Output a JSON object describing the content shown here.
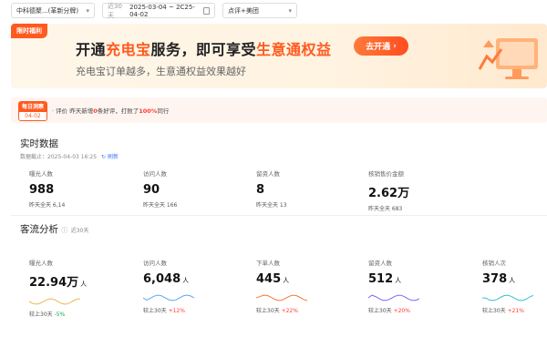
{
  "filters": {
    "store": "中科德聚...(革新分牌)",
    "date_tag": "近30天",
    "date_range": "2025-03-04 ~ 2C25-04-02",
    "area": "点评+美团"
  },
  "banner": {
    "ribbon": "限时福利",
    "headline_pre": "开通",
    "headline_hl1": "充电宝",
    "headline_mid": "服务，即可享受",
    "headline_hl2": "生意通权益",
    "sub": "充电宝订单越多，生意通权益效果越好",
    "cta": "去开通",
    "colors": {
      "accent": "#ff5a1f"
    }
  },
  "tip": {
    "badge_top": "每日洞察",
    "badge_date": "04-02",
    "msg_pre": "· 评价 昨天新增",
    "msg_count": "0",
    "msg_mid": "条好评，打败了",
    "msg_pct": "100%",
    "msg_post": "同行"
  },
  "realtime": {
    "title": "实时数据",
    "meta": "数据截止：2025-04-03 16:25",
    "refresh": "刷新",
    "metrics": [
      {
        "label": "曝光人数",
        "value": "988",
        "compare": "昨天全天 6,14"
      },
      {
        "label": "访问人数",
        "value": "90",
        "compare": "昨天全天 166"
      },
      {
        "label": "留资人数",
        "value": "8",
        "compare": "昨天全天 13"
      },
      {
        "label": "核销售价金额",
        "value": "2.62万",
        "compare": "昨天全天 683"
      }
    ]
  },
  "traffic": {
    "title": "客流分析",
    "meta": "近30天",
    "metrics": [
      {
        "label": "曝光人数",
        "value": "22.94万",
        "unit": "人",
        "compare_pre": "较上30天",
        "delta": "-5%",
        "trend": "down",
        "color": "#f0b65a"
      },
      {
        "label": "访问人数",
        "value": "6,048",
        "unit": "人",
        "compare_pre": "较上30天",
        "delta": "+12%",
        "trend": "up",
        "color": "#5aa8f0"
      },
      {
        "label": "下单人数",
        "value": "445",
        "unit": "人",
        "compare_pre": "较上30天",
        "delta": "+22%",
        "trend": "up",
        "color": "#f07a3a"
      },
      {
        "label": "留资人数",
        "value": "512",
        "unit": "人",
        "compare_pre": "较上30天",
        "delta": "+20%",
        "trend": "up",
        "color": "#7a6af0"
      },
      {
        "label": "核销人次",
        "value": "378",
        "unit": "人",
        "compare_pre": "较上30天",
        "delta": "+21%",
        "trend": "up",
        "color": "#3ac0c8"
      }
    ]
  }
}
